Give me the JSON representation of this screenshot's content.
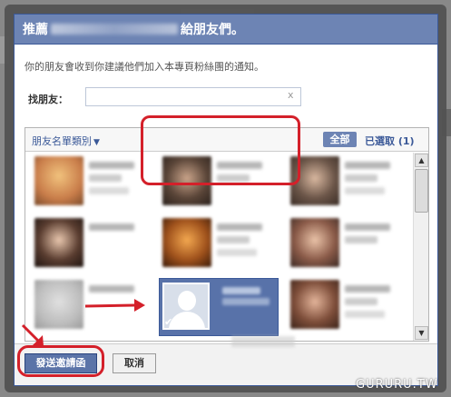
{
  "dialog": {
    "title_prefix": "推薦",
    "title_suffix": "給朋友們。",
    "notice": "你的朋友會收到你建議他們加入本專頁粉絲團的通知。"
  },
  "search": {
    "label": "找朋友：",
    "value": "",
    "clear": "x"
  },
  "list": {
    "category_label": "朋友名單類別",
    "tab_all": "全部",
    "tab_selected": "已選取 (1)"
  },
  "buttons": {
    "send": "發送邀請函",
    "cancel": "取消"
  },
  "watermark": "GURURU.TW",
  "colors": {
    "title_bg": "#6d84b4",
    "accent": "#3b5998",
    "highlight": "#d4202a"
  }
}
